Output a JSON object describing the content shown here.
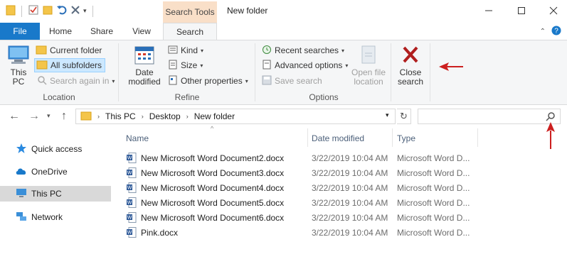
{
  "window": {
    "title": "New folder",
    "context_tab": "Search Tools"
  },
  "tabs": {
    "file": "File",
    "home": "Home",
    "share": "Share",
    "view": "View",
    "search": "Search"
  },
  "ribbon": {
    "location": {
      "this_pc": "This PC",
      "current_folder": "Current folder",
      "all_subfolders": "All subfolders",
      "search_again_in": "Search again in",
      "label": "Location"
    },
    "refine": {
      "date_modified": "Date modified",
      "kind": "Kind",
      "size": "Size",
      "other_properties": "Other properties",
      "label": "Refine"
    },
    "options": {
      "recent_searches": "Recent searches",
      "advanced_options": "Advanced options",
      "save_search": "Save search",
      "open_file_location": "Open file location",
      "label": "Options"
    },
    "close": {
      "close_search": "Close search"
    }
  },
  "address": {
    "crumbs": [
      "This PC",
      "Desktop",
      "New folder"
    ],
    "search_placeholder": ""
  },
  "navpane": {
    "items": [
      {
        "label": "Quick access",
        "icon": "star-icon"
      },
      {
        "label": "OneDrive",
        "icon": "cloud-icon"
      },
      {
        "label": "This PC",
        "icon": "computer-icon",
        "selected": true
      },
      {
        "label": "Network",
        "icon": "network-icon"
      }
    ]
  },
  "filelist": {
    "columns": [
      "Name",
      "Date modified",
      "Type"
    ],
    "rows": [
      {
        "name": "New Microsoft Word Document2.docx",
        "date": "3/22/2019 10:04 AM",
        "type": "Microsoft Word D..."
      },
      {
        "name": "New Microsoft Word Document3.docx",
        "date": "3/22/2019 10:04 AM",
        "type": "Microsoft Word D..."
      },
      {
        "name": "New Microsoft Word Document4.docx",
        "date": "3/22/2019 10:04 AM",
        "type": "Microsoft Word D..."
      },
      {
        "name": "New Microsoft Word Document5.docx",
        "date": "3/22/2019 10:04 AM",
        "type": "Microsoft Word D..."
      },
      {
        "name": "New Microsoft Word Document6.docx",
        "date": "3/22/2019 10:04 AM",
        "type": "Microsoft Word D..."
      },
      {
        "name": "Pink.docx",
        "date": "3/22/2019 10:04 AM",
        "type": "Microsoft Word D..."
      }
    ]
  },
  "colors": {
    "file_tab": "#1979ca",
    "context_tab": "#f9dfc8",
    "selection": "#cce8ff",
    "annotation_arrow": "#cc1f1f",
    "close_x": "#b01e1e"
  }
}
